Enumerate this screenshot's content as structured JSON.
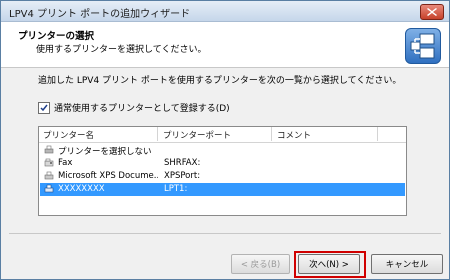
{
  "window": {
    "title": "LPV4 プリント ポートの追加ウィザード"
  },
  "header": {
    "title": "プリンターの選択",
    "subtitle": "使用するプリンターを選択してください。"
  },
  "content": {
    "instruction": "追加した LPV4 プリント ポートを使用するプリンターを次の一覧から選択してください。",
    "checkbox_label": "通常使用するプリンターとして登録する(D)",
    "checkbox_checked": true
  },
  "printer_list": {
    "columns": [
      "プリンター名",
      "プリンターポート",
      "コメント"
    ],
    "rows": [
      {
        "name": "プリンターを選択しない",
        "port": "",
        "comment": "",
        "icon": "printer-none-icon",
        "selected": false
      },
      {
        "name": "Fax",
        "port": "SHRFAX:",
        "comment": "",
        "icon": "fax-icon",
        "selected": false
      },
      {
        "name": "Microsoft XPS Docume...",
        "port": "XPSPort:",
        "comment": "",
        "icon": "printer-icon",
        "selected": false
      },
      {
        "name": "XXXXXXXX",
        "port": "LPT1:",
        "comment": "",
        "icon": "printer-icon",
        "selected": true
      }
    ]
  },
  "buttons": {
    "back": "< 戻る(B)",
    "next": "次へ(N) >",
    "cancel": "キャンセル"
  }
}
